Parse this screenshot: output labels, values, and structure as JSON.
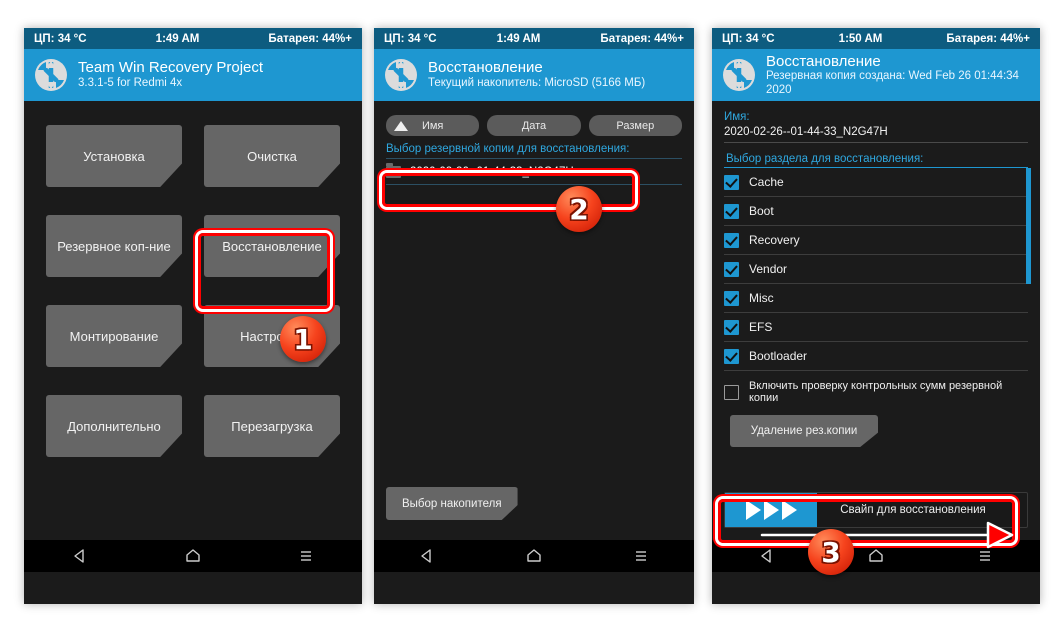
{
  "panels": [
    {
      "status": {
        "cpu": "ЦП: 34 °C",
        "time": "1:49 AM",
        "battery": "Батарея: 44%+"
      },
      "header": {
        "title": "Team Win Recovery Project",
        "subtitle": "3.3.1-5 for Redmi 4x",
        "logo_icon": "twrp-logo-icon"
      },
      "menu": [
        "Установка",
        "Очистка",
        "Резервное коп-ние",
        "Восстановление",
        "Монтирование",
        "Настройки",
        "Дополнительно",
        "Перезагрузка"
      ]
    },
    {
      "status": {
        "cpu": "ЦП: 34 °C",
        "time": "1:49 AM",
        "battery": "Батарея: 44%+"
      },
      "header": {
        "title": "Восстановление",
        "subtitle": "Текущий накопитель: MicroSD (5166 МБ)",
        "logo_icon": "twrp-logo-icon"
      },
      "sort": [
        {
          "label": "Имя",
          "icon": "sort-ascending-triangle-icon",
          "active": true
        },
        {
          "label": "Дата",
          "icon": "",
          "active": false
        },
        {
          "label": "Размер",
          "icon": "",
          "active": false
        }
      ],
      "list_label": "Выбор резервной копии для восстановления:",
      "files": [
        {
          "name": "2020-02-26--01-44-33_N2G47H",
          "icon": "folder-icon"
        }
      ],
      "storage_button": "Выбор накопителя"
    },
    {
      "status": {
        "cpu": "ЦП: 34 °C",
        "time": "1:50 AM",
        "battery": "Батарея: 44%+"
      },
      "header": {
        "title": "Восстановление",
        "subtitle": "Резервная копия создана: Wed Feb 26 01:44:34 2020",
        "logo_icon": "twrp-logo-icon"
      },
      "name_label": "Имя:",
      "name_value": "2020-02-26--01-44-33_N2G47H",
      "partitions_label": "Выбор раздела для восстановления:",
      "partitions": [
        {
          "label": "Cache",
          "checked": true
        },
        {
          "label": "Boot",
          "checked": true
        },
        {
          "label": "Recovery",
          "checked": true
        },
        {
          "label": "Vendor",
          "checked": true
        },
        {
          "label": "Misc",
          "checked": true
        },
        {
          "label": "EFS",
          "checked": true
        },
        {
          "label": "Bootloader",
          "checked": true
        }
      ],
      "checksum_option": {
        "label": "Включить проверку контрольных сумм резервной копии",
        "checked": false
      },
      "delete_button": "Удаление рез.копии",
      "swipe_text": "Свайп для восстановления"
    }
  ],
  "navbar": {
    "back_icon": "back-triangle-icon",
    "home_icon": "home-icon",
    "menu_icon": "menu-lines-icon"
  },
  "annotations": {
    "step1": "1",
    "step2": "2",
    "step3": "3"
  },
  "colors": {
    "accent": "#1e97d1",
    "statusbar": "#0d5c80",
    "button": "#666666",
    "background": "#1b1b1b",
    "annotation": "#ff0000",
    "badge": "#f6431d"
  }
}
